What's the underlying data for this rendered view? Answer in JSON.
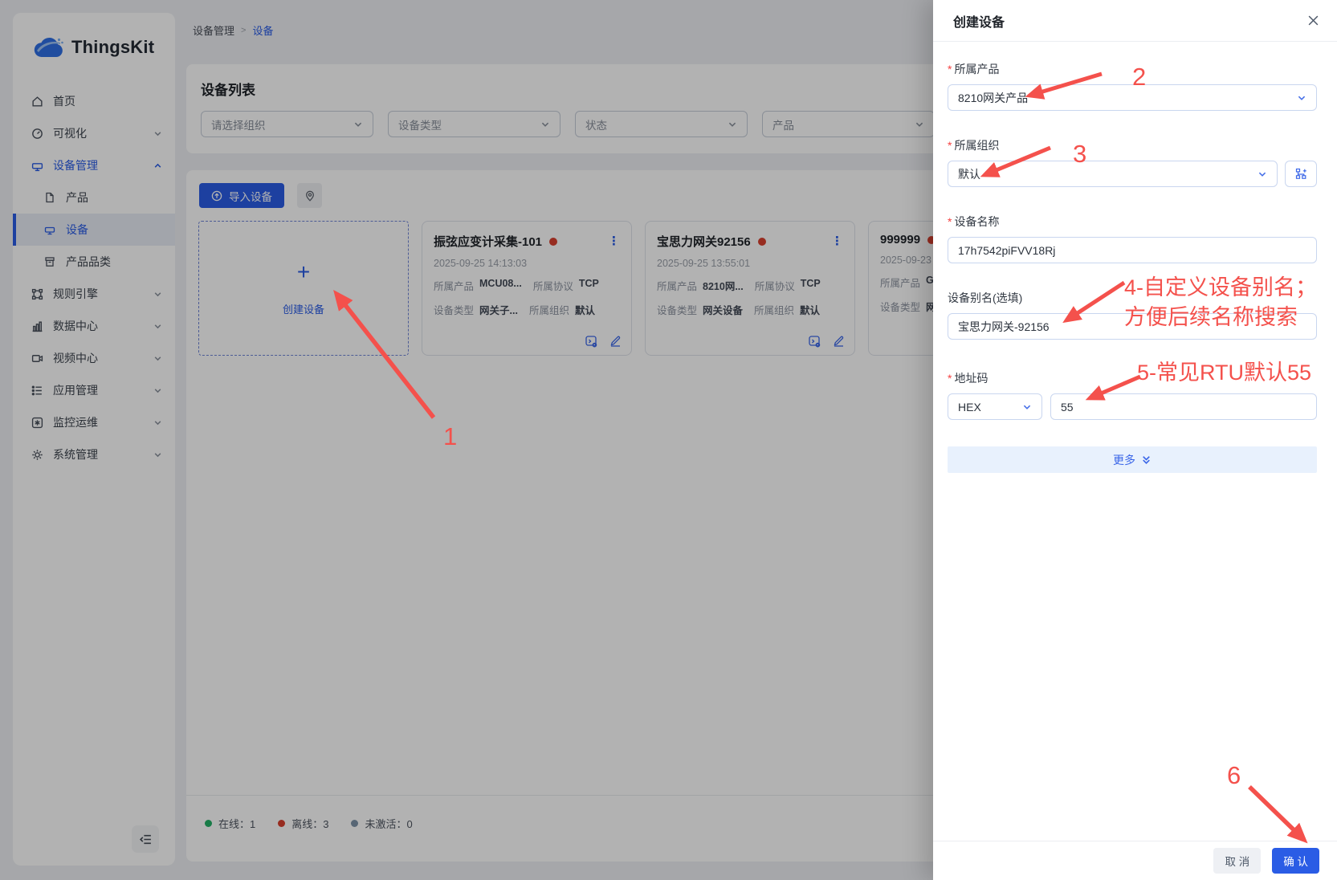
{
  "brand": {
    "name": "ThingsKit"
  },
  "sidebar": {
    "items": [
      {
        "label": "首页"
      },
      {
        "label": "可视化"
      },
      {
        "label": "设备管理"
      },
      {
        "label": "产品"
      },
      {
        "label": "设备"
      },
      {
        "label": "产品品类"
      },
      {
        "label": "规则引擎"
      },
      {
        "label": "数据中心"
      },
      {
        "label": "视频中心"
      },
      {
        "label": "应用管理"
      },
      {
        "label": "监控运维"
      },
      {
        "label": "系统管理"
      }
    ]
  },
  "breadcrumb": {
    "parent": "设备管理",
    "separator": ">",
    "current": "设备"
  },
  "page": {
    "title": "设备列表"
  },
  "filters": {
    "org_placeholder": "请选择组织",
    "type_placeholder": "设备类型",
    "status_placeholder": "状态",
    "product_placeholder": "产品"
  },
  "toolbar": {
    "import_label": "导入设备"
  },
  "create_card": {
    "plus": "+",
    "label": "创建设备"
  },
  "devices": [
    {
      "name": "振弦应变计采集-101",
      "time": "2025-09-25 14:13:03",
      "product_label": "所属产品",
      "product": "MCU08...",
      "protocol_label": "所属协议",
      "protocol": "TCP",
      "type_label": "设备类型",
      "type": "网关子...",
      "org_label": "所属组织",
      "org": "默认",
      "menu": "⋮"
    },
    {
      "name": "宝思力网关92156",
      "time": "2025-09-25 13:55:01",
      "product_label": "所属产品",
      "product": "8210网...",
      "protocol_label": "所属协议",
      "protocol": "TCP",
      "type_label": "设备类型",
      "type": "网关设备",
      "org_label": "所属组织",
      "org": "默认",
      "menu": "⋮"
    },
    {
      "name": "999999",
      "time": "2025-09-23",
      "product_label": "所属产品",
      "product": "G",
      "type_label": "设备类型",
      "type": "网"
    }
  ],
  "legend": {
    "online": "在线：1",
    "offline": "离线：3",
    "inactive": "未激活：0"
  },
  "drawer": {
    "title": "创建设备",
    "product_label": "所属产品",
    "product_value": "8210网关产品",
    "org_label": "所属组织",
    "org_value": "默认",
    "name_label": "设备名称",
    "name_value": "17h7542piFVV18Rj",
    "alias_label": "设备别名(选填)",
    "alias_value": "宝思力网关-92156",
    "addr_label": "地址码",
    "addr_mode": "HEX",
    "addr_value": "55",
    "more_label": "更多",
    "cancel_label": "取 消",
    "confirm_label": "确 认"
  },
  "annotations": {
    "step1": "1",
    "step2": "2",
    "step3": "3",
    "step6": "6",
    "step4_line1": "4-自定义设备别名；",
    "step4_line2": "方便后续名称搜索",
    "step5": "5-常见RTU默认55"
  },
  "colors": {
    "accent": "#2a5ce5",
    "annotation": "#f4514c",
    "online": "#23b066",
    "offline": "#d9402e",
    "inactive": "#7d93a8"
  }
}
